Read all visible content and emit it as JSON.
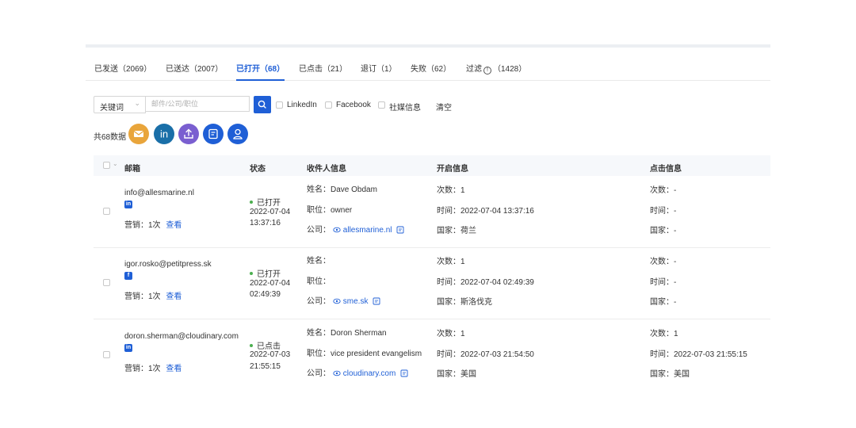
{
  "tabs": [
    {
      "label": "已发送（2069）"
    },
    {
      "label": "已送达（2007）"
    },
    {
      "label": "已打开（68）"
    },
    {
      "label": "已点击（21）"
    },
    {
      "label": "退订（1）"
    },
    {
      "label": "失败（62）"
    },
    {
      "label_a": "过滤",
      "label_b": "（1428）"
    }
  ],
  "filter": {
    "select_value": "关键词",
    "search_placeholder": "邮件/公司/职位",
    "opt_linkedin": "LinkedIn",
    "opt_facebook": "Facebook",
    "opt_social": "社媒信息",
    "clear": "清空"
  },
  "summary": {
    "count": "共68数据"
  },
  "colors": {
    "accent": "#1f5fd6",
    "email_btn": "#e9a53b",
    "linkedin_btn": "#1a6fa8",
    "upload_btn": "#7a5fd0",
    "doc_btn": "#1f5fd6",
    "contact_btn": "#1f5fd6"
  },
  "table": {
    "headers": {
      "email": "邮箱",
      "status": "状态",
      "recipient": "收件人信息",
      "open": "开启信息",
      "click": "点击信息"
    },
    "rows": [
      {
        "email": "info@allesmarine.nl",
        "social": "in",
        "marketing": "营销：1次",
        "view": "查看",
        "status": "已打开",
        "status_date": "2022-07-04",
        "status_time": "13:37:16",
        "name": "姓名：Dave Obdam",
        "position": "职位：owner",
        "company_label": "公司：",
        "company": "allesmarine.nl",
        "open_count": "次数：1",
        "open_time": "时间：2022-07-04 13:37:16",
        "open_country": "国家：荷兰",
        "click_count": "次数：-",
        "click_time": "时间：-",
        "click_country": "国家：-"
      },
      {
        "email": "igor.rosko@petitpress.sk",
        "social": "f",
        "marketing": "营销：1次",
        "view": "查看",
        "status": "已打开",
        "status_date": "2022-07-04",
        "status_time": "02:49:39",
        "name": "姓名：",
        "position": "职位：",
        "company_label": "公司：",
        "company": "sme.sk",
        "open_count": "次数：1",
        "open_time": "时间：2022-07-04 02:49:39",
        "open_country": "国家：斯洛伐克",
        "click_count": "次数：-",
        "click_time": "时间：-",
        "click_country": "国家：-"
      },
      {
        "email": "doron.sherman@cloudinary.com",
        "social": "in",
        "marketing": "营销：1次",
        "view": "查看",
        "status": "已点击",
        "status_date": "2022-07-03",
        "status_time": "21:55:15",
        "name": "姓名：Doron Sherman",
        "position": "职位：vice president evangelism",
        "company_label": "公司：",
        "company": "cloudinary.com",
        "open_count": "次数：1",
        "open_time": "时间：2022-07-03 21:54:50",
        "open_country": "国家：美国",
        "click_count": "次数：1",
        "click_time": "时间：2022-07-03 21:55:15",
        "click_country": "国家：美国"
      }
    ]
  }
}
